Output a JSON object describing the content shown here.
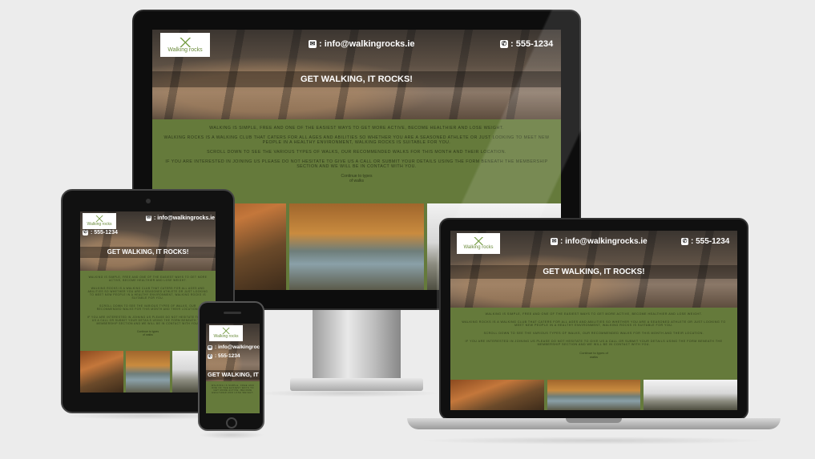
{
  "site": {
    "logo_text": "Walking rocks",
    "email": ": info@walkingrocks.ie",
    "phone": ": 555-1234",
    "email_icon": "envelope-icon",
    "phone_icon": "phone-icon",
    "tagline": "GET WALKING, IT ROCKS!",
    "tagline_short": "GET WALKING, IT",
    "intro": [
      "Walking is simple, free and one of the easiest ways to get more active, become healthier and lose weight.",
      "Walking rocks is a walking club that caters for all ages and abilities so whether you are a seasoned athlete or just looking to meet new people in a healthy environment, walking rocks is suitable for you.",
      "Scroll down to see the various types of walks, our recommended walks for this month and their location.",
      "If you are interested in joining us please do not hesitate to give us a call or submit your details using the form beneath the membership section and we will be in contact with you."
    ],
    "cta": "Continue to types of walks",
    "colors": {
      "body_bg": "#657a3b",
      "text": "#2e3a1a",
      "banner": "#ffffff"
    }
  }
}
